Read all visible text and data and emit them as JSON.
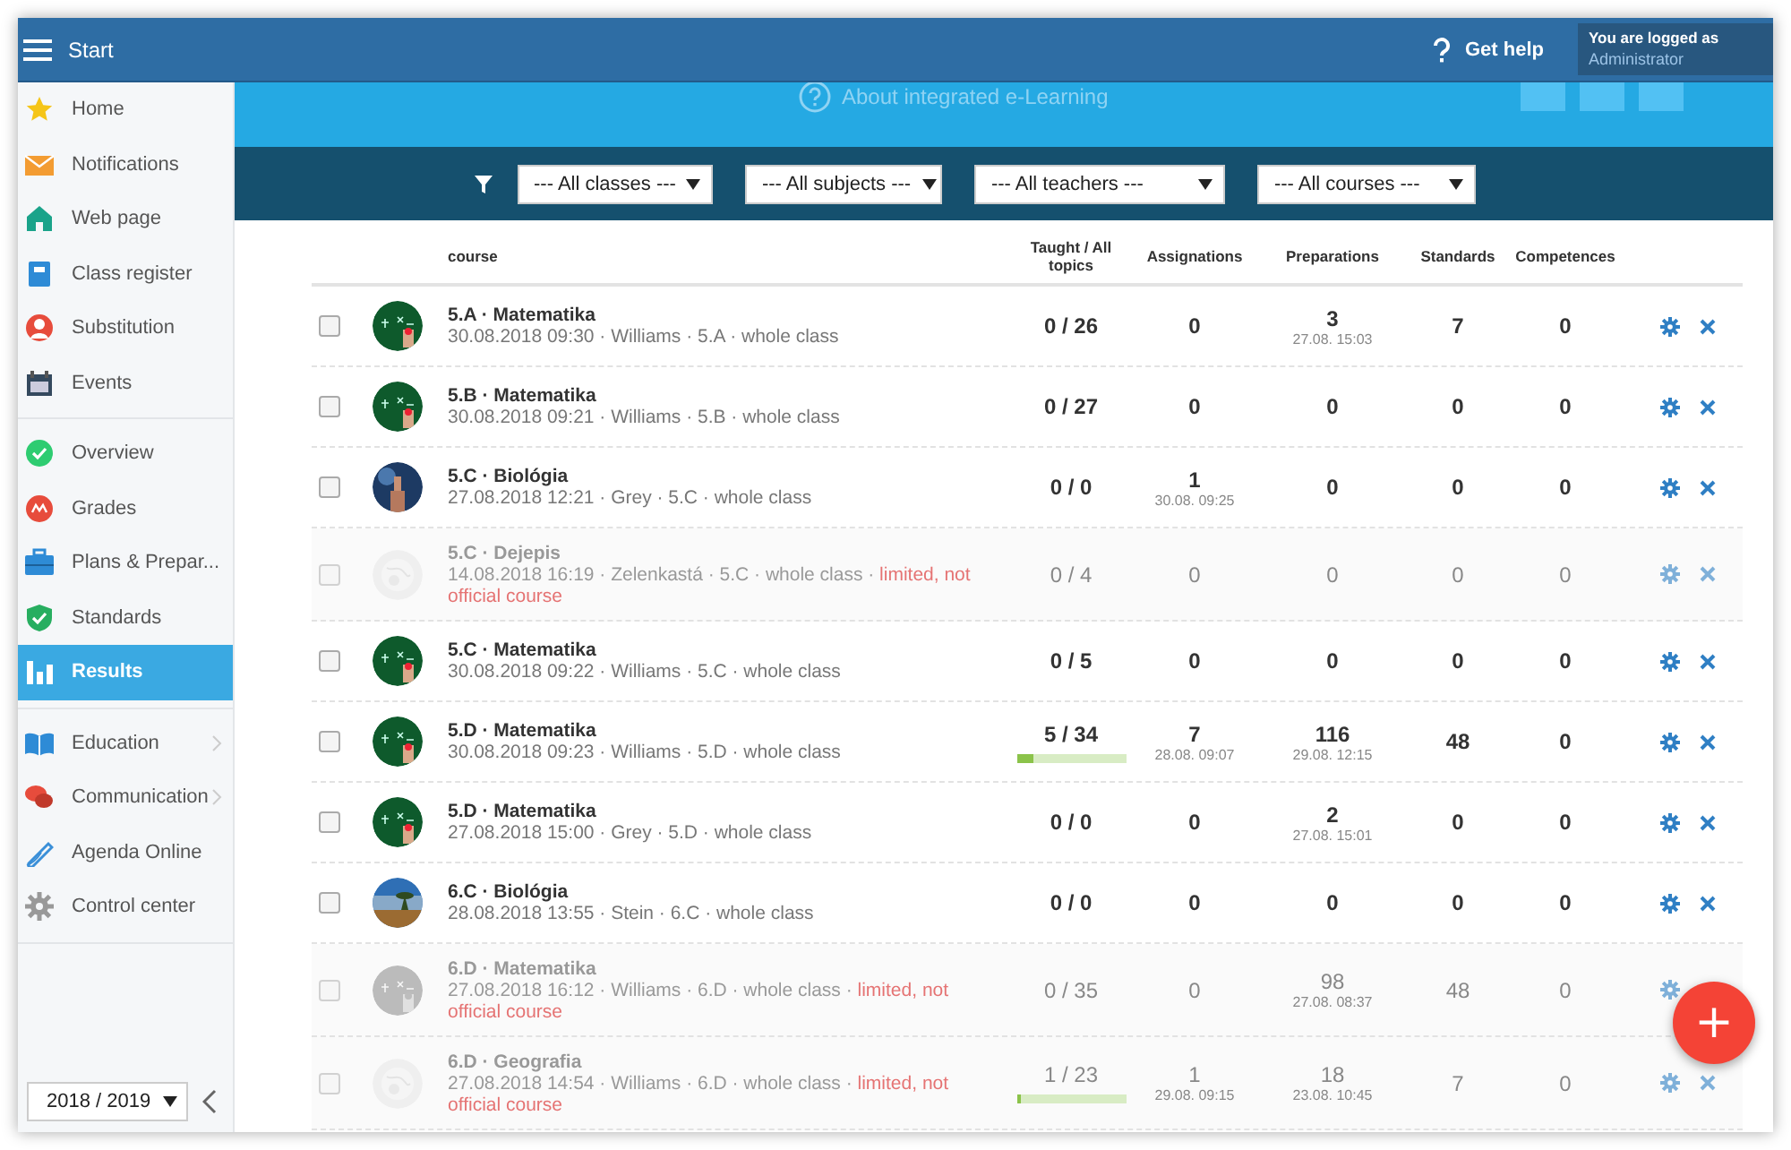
{
  "topbar": {
    "title": "Start",
    "help": "Get help",
    "login_label": "You are logged as",
    "login_user": "Administrator"
  },
  "banner": {
    "text": "About integrated e-Learning"
  },
  "filters": [
    {
      "value": "--- All classes ---"
    },
    {
      "value": "--- All subjects ---"
    },
    {
      "value": "--- All teachers ---"
    },
    {
      "value": "--- All courses ---"
    }
  ],
  "sidebar": {
    "groups": [
      {
        "items": [
          {
            "label": "Home",
            "selected": false,
            "submenu": false
          },
          {
            "label": "Notifications",
            "selected": false,
            "submenu": false
          },
          {
            "label": "Web page",
            "selected": false,
            "submenu": false
          },
          {
            "label": "Class register",
            "selected": false,
            "submenu": false
          },
          {
            "label": "Substitution",
            "selected": false,
            "submenu": false
          },
          {
            "label": "Events",
            "selected": false,
            "submenu": false
          }
        ]
      },
      {
        "items": [
          {
            "label": "Overview",
            "selected": false,
            "submenu": false
          },
          {
            "label": "Grades",
            "selected": false,
            "submenu": false
          },
          {
            "label": "Plans & Prepar...",
            "selected": false,
            "submenu": false
          },
          {
            "label": "Standards",
            "selected": false,
            "submenu": false
          },
          {
            "label": "Results",
            "selected": true,
            "submenu": false
          }
        ]
      },
      {
        "items": [
          {
            "label": "Education",
            "selected": false,
            "submenu": true
          },
          {
            "label": "Communication",
            "selected": false,
            "submenu": true
          },
          {
            "label": "Agenda Online",
            "selected": false,
            "submenu": false
          },
          {
            "label": "Control center",
            "selected": false,
            "submenu": false
          }
        ]
      }
    ],
    "year": "2018 / 2019"
  },
  "table": {
    "columns": [
      "course",
      "Taught / All topics",
      "Assignations",
      "Preparations",
      "Standards",
      "Competences"
    ],
    "rows": [
      {
        "checked": false,
        "limited": false,
        "title": "5.A · Matematika",
        "details": "30.08.2018 09:30 · Williams · 5.A · whole class",
        "taught": "0 / 26",
        "assignations": {
          "value": "0"
        },
        "preparations": {
          "value": "3",
          "date": "27.08. 15:03"
        },
        "standards": "7",
        "competences": "0"
      },
      {
        "checked": false,
        "limited": false,
        "title": "5.B · Matematika",
        "details": "30.08.2018 09:21 · Williams · 5.B · whole class",
        "taught": "0 / 27",
        "assignations": {
          "value": "0"
        },
        "preparations": {
          "value": "0"
        },
        "standards": "0",
        "competences": "0"
      },
      {
        "checked": false,
        "limited": false,
        "title": "5.C · Biológia",
        "details": "27.08.2018 12:21 · Grey · 5.C · whole class",
        "taught": "0 / 0",
        "assignations": {
          "value": "1",
          "date": "30.08. 09:25"
        },
        "preparations": {
          "value": "0"
        },
        "standards": "0",
        "competences": "0"
      },
      {
        "checked": false,
        "limited": true,
        "title": "5.C · Dejepis",
        "details": "14.08.2018 16:19 · Zelenkastá · 5.C · whole class · ",
        "note": "limited, not official course",
        "taught": "0 / 4",
        "assignations": {
          "value": "0"
        },
        "preparations": {
          "value": "0"
        },
        "standards": "0",
        "competences": "0"
      },
      {
        "checked": false,
        "limited": false,
        "title": "5.C · Matematika",
        "details": "30.08.2018 09:22 · Williams · 5.C · whole class",
        "taught": "0 / 5",
        "assignations": {
          "value": "0"
        },
        "preparations": {
          "value": "0"
        },
        "standards": "0",
        "competences": "0"
      },
      {
        "checked": false,
        "limited": false,
        "title": "5.D · Matematika",
        "details": "30.08.2018 09:23 · Williams · 5.D · whole class",
        "taught": "5 / 34",
        "progress": {
          "level": 0.15
        },
        "assignations": {
          "value": "7",
          "date": "28.08. 09:07"
        },
        "preparations": {
          "value": "116",
          "date": "29.08. 12:15"
        },
        "standards": "48",
        "competences": "0"
      },
      {
        "checked": false,
        "limited": false,
        "title": "5.D · Matematika",
        "details": "27.08.2018 15:00 · Grey · 5.D · whole class",
        "taught": "0 / 0",
        "assignations": {
          "value": "0"
        },
        "preparations": {
          "value": "2",
          "date": "27.08. 15:01"
        },
        "standards": "0",
        "competences": "0"
      },
      {
        "checked": false,
        "limited": false,
        "title": "6.C · Biológia",
        "details": "28.08.2018 13:55 · Stein · 6.C · whole class",
        "taught": "0 / 0",
        "assignations": {
          "value": "0"
        },
        "preparations": {
          "value": "0"
        },
        "standards": "0",
        "competences": "0"
      },
      {
        "checked": false,
        "limited": true,
        "title": "6.D · Matematika",
        "details": "27.08.2018 16:12 · Williams · 6.D · whole class · ",
        "note": "limited, not official course",
        "taught": "0 / 35",
        "assignations": {
          "value": "0"
        },
        "preparations": {
          "value": "98",
          "date": "27.08. 08:37"
        },
        "standards": "48",
        "competences": "0"
      },
      {
        "checked": false,
        "limited": true,
        "title": "6.D · Geografia",
        "details": "27.08.2018 14:54 · Williams · 6.D · whole class · ",
        "note": "limited, not official course",
        "taught": "1 / 23",
        "progress": {
          "level": 0.04
        },
        "assignations": {
          "value": "1",
          "date": "29.08. 09:15"
        },
        "preparations": {
          "value": "18",
          "date": "23.08. 10:45"
        },
        "standards": "7",
        "competences": "0"
      }
    ]
  },
  "fab": {
    "label": "+"
  }
}
